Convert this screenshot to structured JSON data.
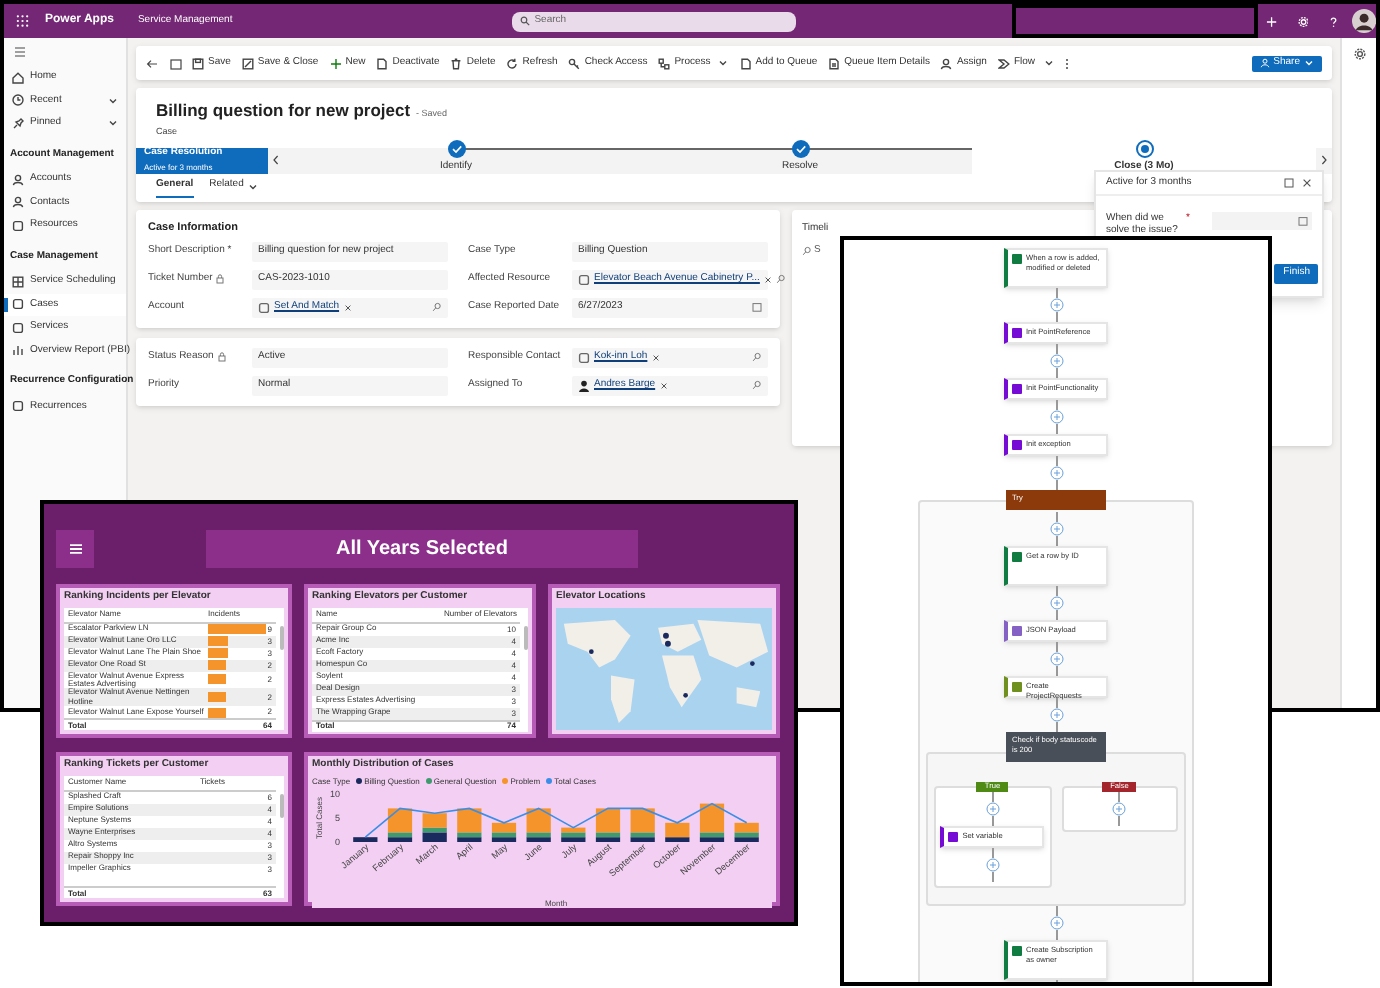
{
  "app_bar": {
    "app_name": "Power Apps",
    "environment": "Service Management",
    "search": {
      "placeholder": "Search"
    }
  },
  "sidebar": {
    "items": [
      {
        "kind": "item",
        "label": "Home",
        "selected": false,
        "has_submenu": false
      },
      {
        "kind": "item",
        "label": "Recent",
        "selected": false,
        "has_submenu": true
      },
      {
        "kind": "item",
        "label": "Pinned",
        "selected": false,
        "has_submenu": true
      },
      {
        "kind": "header",
        "label": "Account Management"
      },
      {
        "kind": "item",
        "label": "Accounts",
        "selected": false,
        "has_submenu": false
      },
      {
        "kind": "item",
        "label": "Contacts",
        "selected": false,
        "has_submenu": false
      },
      {
        "kind": "item",
        "label": "Resources",
        "selected": false,
        "has_submenu": false
      },
      {
        "kind": "header",
        "label": "Case Management"
      },
      {
        "kind": "item",
        "label": "Service Scheduling",
        "selected": false,
        "has_submenu": false
      },
      {
        "kind": "item",
        "label": "Cases",
        "selected": true,
        "has_submenu": false
      },
      {
        "kind": "item",
        "label": "Services",
        "selected": false,
        "has_submenu": false
      },
      {
        "kind": "item",
        "label": "Overview Report (PBI)",
        "selected": false,
        "has_submenu": false
      },
      {
        "kind": "header",
        "label": "Recurrence Configuration"
      },
      {
        "kind": "item",
        "label": "Recurrences",
        "selected": false,
        "has_submenu": false
      }
    ]
  },
  "command_bar": {
    "commands": [
      {
        "label": "Save",
        "has_menu": false
      },
      {
        "label": "Save & Close",
        "has_menu": false
      },
      {
        "label": "New",
        "has_menu": false
      },
      {
        "label": "Deactivate",
        "has_menu": false
      },
      {
        "label": "Delete",
        "has_menu": false
      },
      {
        "label": "Refresh",
        "has_menu": false
      },
      {
        "label": "Check Access",
        "has_menu": false
      },
      {
        "label": "Process",
        "has_menu": true
      },
      {
        "label": "Add to Queue",
        "has_menu": false
      },
      {
        "label": "Queue Item Details",
        "has_menu": false
      },
      {
        "label": "Assign",
        "has_menu": false
      },
      {
        "label": "Flow",
        "has_menu": true
      }
    ],
    "share": "Share"
  },
  "record": {
    "title": "Billing question for new project",
    "save_state": "- Saved",
    "entity": "Case"
  },
  "process": {
    "name": "Case Resolution",
    "duration": "Active for 3 months",
    "stages": [
      {
        "label": "Identify",
        "completed": true,
        "selected": false
      },
      {
        "label": "Resolve",
        "completed": true,
        "selected": false
      },
      {
        "label": "Close (3 Mo)",
        "completed": false,
        "selected": true
      }
    ]
  },
  "stage_flyout": {
    "status": "Active for 3 months",
    "question": "When did we solve the issue?",
    "required_mark": "*",
    "finish": "Finish"
  },
  "tabs": [
    {
      "label": "General",
      "selected": true,
      "has_menu": false
    },
    {
      "label": "Related",
      "selected": false,
      "has_menu": true
    }
  ],
  "sections": [
    {
      "title": "Case Information",
      "fields": [
        {
          "label": "Short Description *",
          "kind": "text",
          "locked": false,
          "value": "Billing question for new project"
        },
        {
          "label": "Case Type",
          "kind": "text",
          "locked": false,
          "value": "Billing Question"
        },
        {
          "label": "Ticket Number",
          "kind": "text",
          "locked": true,
          "value": "CAS-2023-1010"
        },
        {
          "label": "Affected Resource",
          "kind": "lookup",
          "locked": false,
          "value": "Elevator Beach Avenue Cabinetry P..."
        },
        {
          "label": "Account",
          "kind": "lookup",
          "locked": false,
          "value": "Set And Match"
        },
        {
          "label": "Case Reported Date",
          "kind": "date",
          "locked": false,
          "value": "6/27/2023"
        }
      ]
    },
    {
      "fields": [
        {
          "label": "Status Reason",
          "kind": "text",
          "locked": true,
          "value": "Active"
        },
        {
          "label": "Responsible Contact",
          "kind": "lookup",
          "locked": false,
          "value": "Kok-inn Loh"
        },
        {
          "label": "Priority",
          "kind": "text",
          "locked": false,
          "value": "Normal"
        },
        {
          "label": "Assigned To",
          "kind": "person",
          "locked": false,
          "value": "Andres Barge"
        }
      ]
    }
  ],
  "timeline": {
    "title": "Timeli",
    "search_placeholder": "S"
  },
  "dashboard": {
    "title": "All Years Selected",
    "incidents": {
      "title": "Ranking Incidents per Elevator",
      "columns": [
        "Elevator Name",
        "Incidents"
      ],
      "rows": [
        {
          "name": "Escalator Parkview LN",
          "value": "9"
        },
        {
          "name": "Elevator Walnut Lane Oro LLC",
          "value": "3"
        },
        {
          "name": "Elevator Walnut Lane The Plain Shoe",
          "value": "3"
        },
        {
          "name": "Elevator One Road St",
          "value": "2"
        },
        {
          "name": "Elevator Walnut Avenue Express Estates Advertising",
          "value": "2"
        },
        {
          "name": "Elevator Walnut Avenue Nettingen Hotline",
          "value": "2"
        },
        {
          "name": "Elevator Walnut Lane Expose Yourself",
          "value": "2"
        }
      ],
      "total_label": "Total",
      "total": "64"
    },
    "elevators": {
      "title": "Ranking Elevators per Customer",
      "columns": [
        "Name",
        "Number of Elevators"
      ],
      "rows": [
        {
          "name": "Repair Group Co",
          "value": "10"
        },
        {
          "name": "Acme Inc",
          "value": "4"
        },
        {
          "name": "Ecoft Factory",
          "value": "4"
        },
        {
          "name": "Homespun Co",
          "value": "4"
        },
        {
          "name": "Soylent",
          "value": "4"
        },
        {
          "name": "Deal Design",
          "value": "3"
        },
        {
          "name": "Express Estates Advertising",
          "value": "3"
        },
        {
          "name": "The Wrapping Grape",
          "value": "3"
        }
      ],
      "total_label": "Total",
      "total": "74"
    },
    "map": {
      "title": "Elevator Locations",
      "kind": "picture"
    },
    "tickets": {
      "title": "Ranking Tickets per Customer",
      "columns": [
        "Customer Name",
        "Tickets"
      ],
      "rows": [
        {
          "name": "Splashed Craft",
          "value": "6"
        },
        {
          "name": "Empire Solutions",
          "value": "4"
        },
        {
          "name": "Neptune Systems",
          "value": "4"
        },
        {
          "name": "Wayne Enterprises",
          "value": "4"
        },
        {
          "name": "Altro Systems",
          "value": "3"
        },
        {
          "name": "Repair Shoppy Inc",
          "value": "3"
        },
        {
          "name": "Impeller Graphics",
          "value": "3"
        }
      ],
      "total_label": "Total",
      "total": "63"
    },
    "monthly": {
      "title": "Monthly Distribution of Cases",
      "legend_title": "Case Type",
      "chart_data": {
        "type": "bar",
        "stacked": true,
        "legend": "top",
        "xlabel": "Month",
        "ylabel": "Total Cases",
        "categories": [
          "January",
          "February",
          "March",
          "April",
          "May",
          "June",
          "July",
          "August",
          "September",
          "October",
          "November",
          "December"
        ],
        "ylim": [
          0,
          10
        ],
        "yticks": [
          0,
          5,
          10
        ],
        "series": [
          {
            "name": "Billing Question",
            "color": "#1b2a5e",
            "values": [
              1,
              1,
              2,
              1,
              1,
              1,
              1,
              1,
              1,
              1,
              1,
              1
            ]
          },
          {
            "name": "General Question",
            "color": "#3f9a6e",
            "values": [
              0,
              1,
              1,
              1,
              1,
              1,
              1,
              1,
              1,
              0,
              1,
              1
            ]
          },
          {
            "name": "Problem",
            "color": "#f4942a",
            "values": [
              0,
              5,
              3,
              5,
              2,
              5,
              1,
              5,
              5,
              3,
              6,
              2
            ]
          },
          {
            "name": "Total Cases",
            "type": "line",
            "color": "#3b8ee8",
            "values": [
              1,
              7,
              6,
              7,
              4,
              7,
              3,
              7,
              7,
              4,
              8,
              4
            ]
          }
        ]
      }
    }
  },
  "flow": {
    "steps": [
      {
        "kind": "trigger",
        "label": "When a row is added, modified or deleted",
        "color": "#107c41"
      },
      {
        "kind": "action",
        "label": "Init PointReference",
        "color": "#770bd6"
      },
      {
        "kind": "action",
        "label": "Init PointFunctionality",
        "color": "#770bd6"
      },
      {
        "kind": "action",
        "label": "Init exception",
        "color": "#770bd6"
      },
      {
        "kind": "scope",
        "label": "Try",
        "color": "#8c3a0c",
        "children": [
          {
            "kind": "trigger",
            "label": "Get a row by ID",
            "color": "#107c41"
          },
          {
            "kind": "action",
            "label": "JSON Payload",
            "color": "#8661c5"
          },
          {
            "kind": "action",
            "label": "Create ProjectRequests",
            "color": "#6f8f1e"
          },
          {
            "kind": "condition",
            "label": "Check if body statuscode is 200",
            "color": "#484f58",
            "true_label": "True",
            "false_label": "False",
            "true_steps": [
              {
                "kind": "action",
                "label": "Set variable",
                "color": "#770bd6"
              }
            ]
          },
          {
            "kind": "trigger",
            "label": "Create Subscription as owner",
            "color": "#107c41"
          }
        ]
      }
    ]
  }
}
